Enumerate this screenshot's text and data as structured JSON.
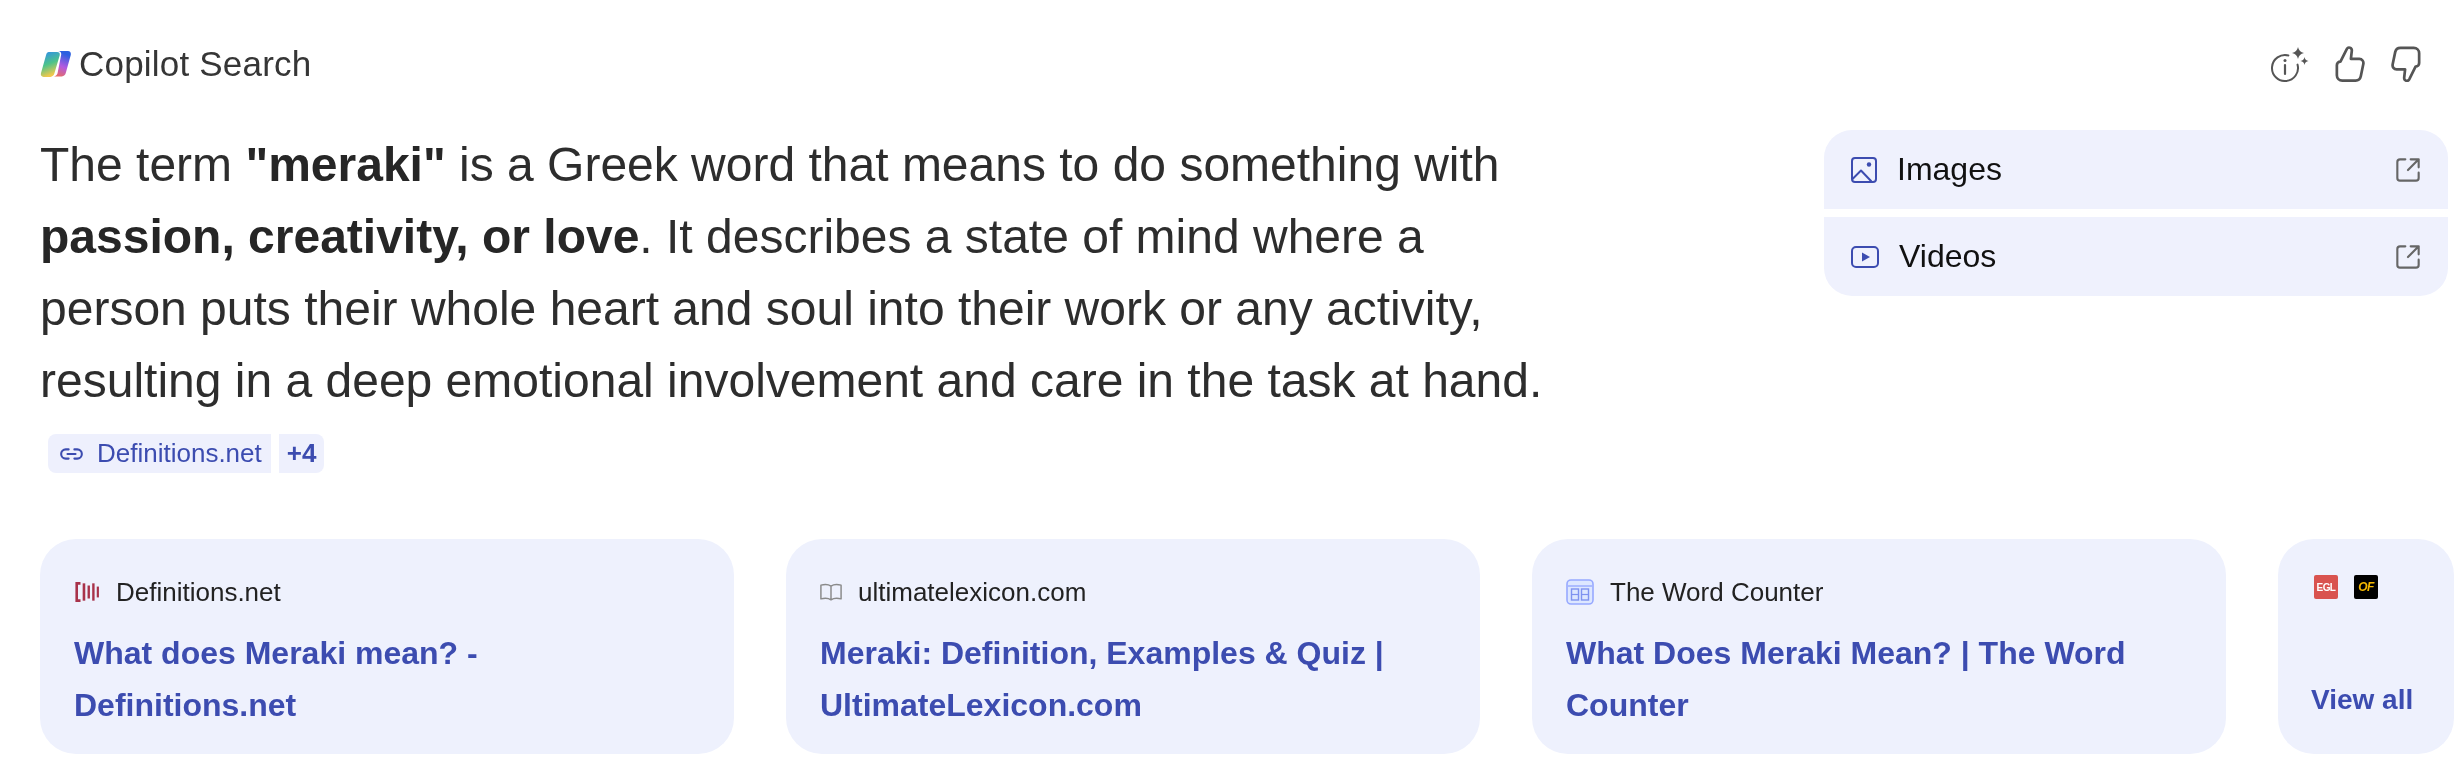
{
  "header": {
    "title": "Copilot Search"
  },
  "answer": {
    "text": "The term **\"meraki\"** is a Greek word that means to do something with **passion, creativity, or love**. It describes a state of mind where a person puts their whole heart and soul into their work or any activity, resulting in a deep emotional involvement and care in the task at hand.",
    "citation": {
      "label": "Definitions.net"
    },
    "more": "+4"
  },
  "media_links": [
    {
      "label": "Images"
    },
    {
      "label": "Videos"
    }
  ],
  "sources": [
    {
      "site": "Definitions.net",
      "title": "What does Meraki mean? - Definitions.net"
    },
    {
      "site": "ultimatelexicon.com",
      "title": "Meraki: Definition, Examples & Quiz | UltimateLexicon.com"
    },
    {
      "site": "The Word Counter",
      "title": "What Does Meraki Mean? | The Word Counter"
    }
  ],
  "view_all": {
    "logos": [
      {
        "text": "EGL",
        "color": "#d9534f"
      },
      {
        "text": "OF",
        "color": "#000000"
      }
    ],
    "label": "View all"
  }
}
